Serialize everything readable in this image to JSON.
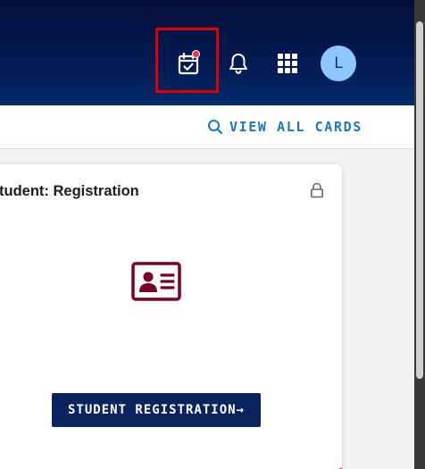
{
  "header": {
    "icons": [
      "calendar-check-icon",
      "bell-icon",
      "apps-grid-icon"
    ],
    "notification_dot_color": "#e6334a",
    "avatar_initial": "L",
    "highlight_color": "#e00000"
  },
  "subbar": {
    "view_all_label": "VIEW ALL CARDS",
    "view_all_icon": "search-icon"
  },
  "card": {
    "title": "Student:  Registration",
    "lock_icon": "lock-icon",
    "main_icon": "id-card-icon",
    "button_label": "STUDENT REGISTRATION→"
  },
  "colors": {
    "header_bg": "#031a52",
    "link": "#1a78c2",
    "button_bg": "#0b2460",
    "card_accent": "#7a0025",
    "icon_maroon": "#7a0025",
    "avatar_bg": "#8cc8ff"
  }
}
